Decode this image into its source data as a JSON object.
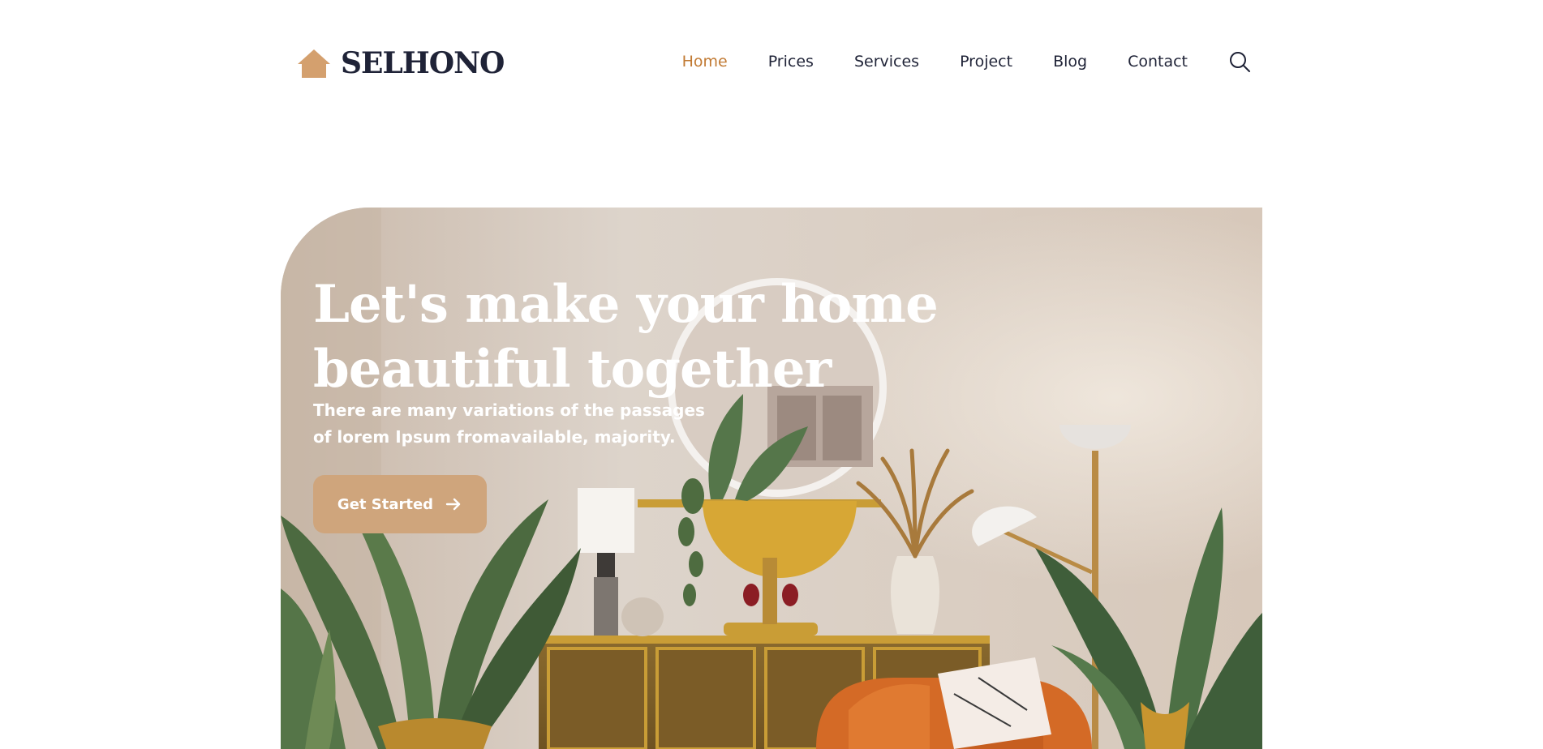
{
  "brand": {
    "name": "SELHONO",
    "icon": "house-icon",
    "color": "#d4a06e"
  },
  "nav": {
    "items": [
      {
        "label": "Home",
        "active": true
      },
      {
        "label": "Prices",
        "active": false
      },
      {
        "label": "Services",
        "active": false
      },
      {
        "label": "Project",
        "active": false
      },
      {
        "label": "Blog",
        "active": false
      },
      {
        "label": "Contact",
        "active": false
      }
    ],
    "search_icon": "search-icon",
    "active_color": "#c17a33",
    "text_color": "#1f2337"
  },
  "hero": {
    "title_line1": "Let's make your home",
    "title_line2": "beautiful together",
    "subtitle_line1": "There are many variations of the passages",
    "subtitle_line2": "of lorem Ipsum fromavailable, majority.",
    "cta_label": "Get Started",
    "cta_icon": "arrow-right-icon",
    "cta_color": "#cfa57c"
  }
}
